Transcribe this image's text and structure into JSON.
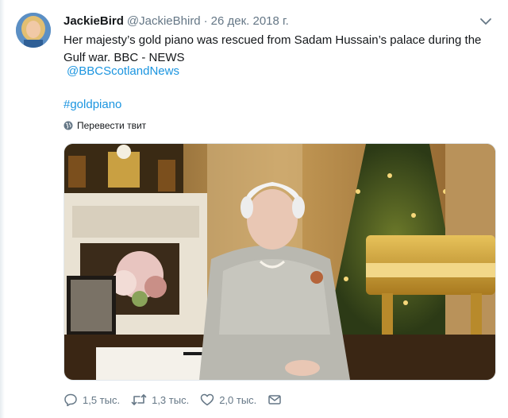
{
  "tweet": {
    "display_name": "JackieBird",
    "handle": "@JackieBhird",
    "separator": "·",
    "date": "26 дек. 2018 г.",
    "text": "Her majesty’s gold piano was rescued from Sadam Hussain’s palace during the Gulf war. BBC - NEWS",
    "mention": "@BBCScotlandNews",
    "hashtag": "#goldpiano",
    "translate_label": "Перевести твит",
    "menu_icon": "chevron-down-icon"
  },
  "actions": {
    "reply_count": "1,5 тыс.",
    "retweet_count": "1,3 тыс.",
    "like_count": "2,0 тыс.",
    "icons": [
      "reply-icon",
      "retweet-icon",
      "like-icon",
      "message-icon"
    ]
  },
  "colors": {
    "link": "#1b95e0",
    "secondary_text": "#657786",
    "primary_text": "#14171a"
  }
}
